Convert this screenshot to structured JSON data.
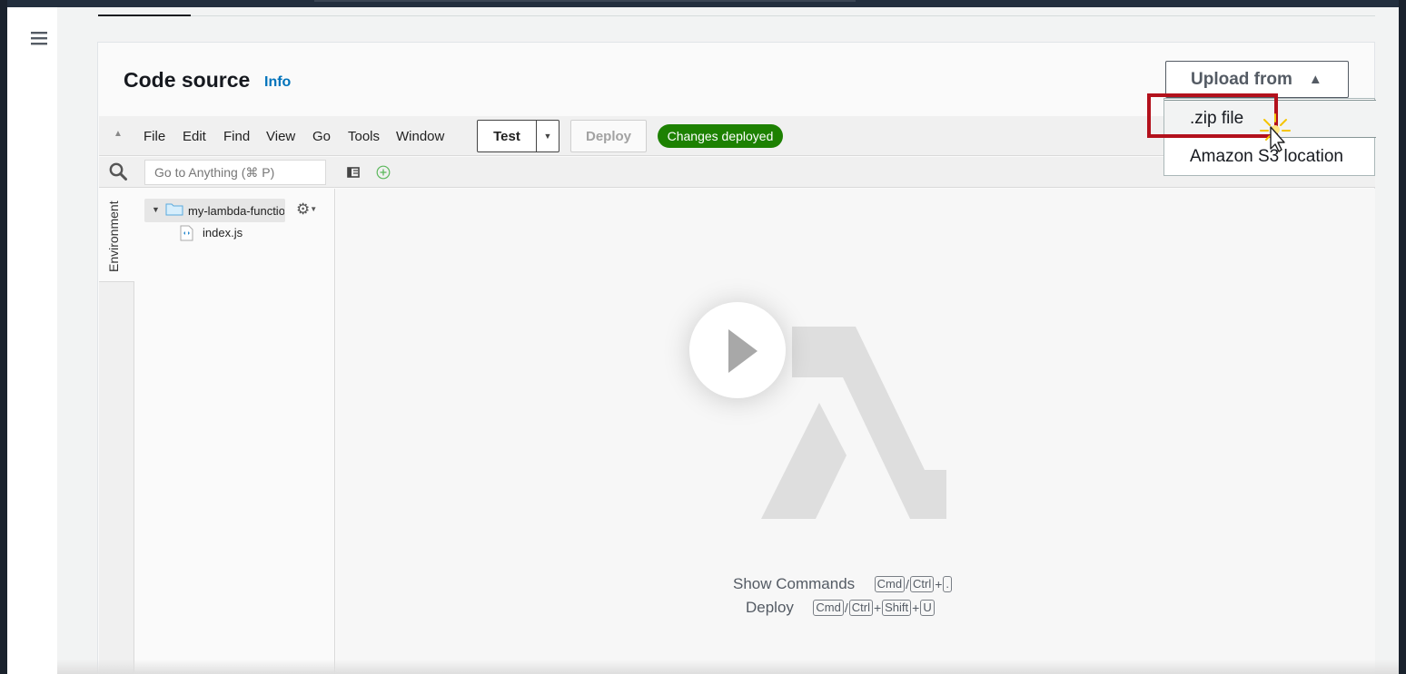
{
  "panel": {
    "title": "Code source",
    "info_link": "Info"
  },
  "upload": {
    "label": "Upload from",
    "caret": "▲",
    "options": [
      ".zip file",
      "Amazon S3 location"
    ]
  },
  "toolbar": {
    "menu": [
      "File",
      "Edit",
      "Find",
      "View",
      "Go",
      "Tools",
      "Window"
    ],
    "test_label": "Test",
    "deploy_label": "Deploy",
    "status": "Changes deployed"
  },
  "search": {
    "placeholder": "Go to Anything (⌘ P)"
  },
  "sidebar": {
    "tab_label": "Environment"
  },
  "file_tree": {
    "root_folder": "my-lambda-function",
    "files": [
      "index.js"
    ]
  },
  "shortcuts": [
    {
      "label": "Show Commands",
      "keys": [
        "Cmd",
        "Ctrl",
        "."
      ]
    },
    {
      "label": "Deploy",
      "keys": [
        "Cmd",
        "Ctrl",
        "Shift",
        "U"
      ]
    }
  ],
  "colors": {
    "status_green": "#1d8102",
    "info_blue": "#0073bb",
    "highlight_red": "#b3111c",
    "aws_navbar": "#232f3e"
  }
}
